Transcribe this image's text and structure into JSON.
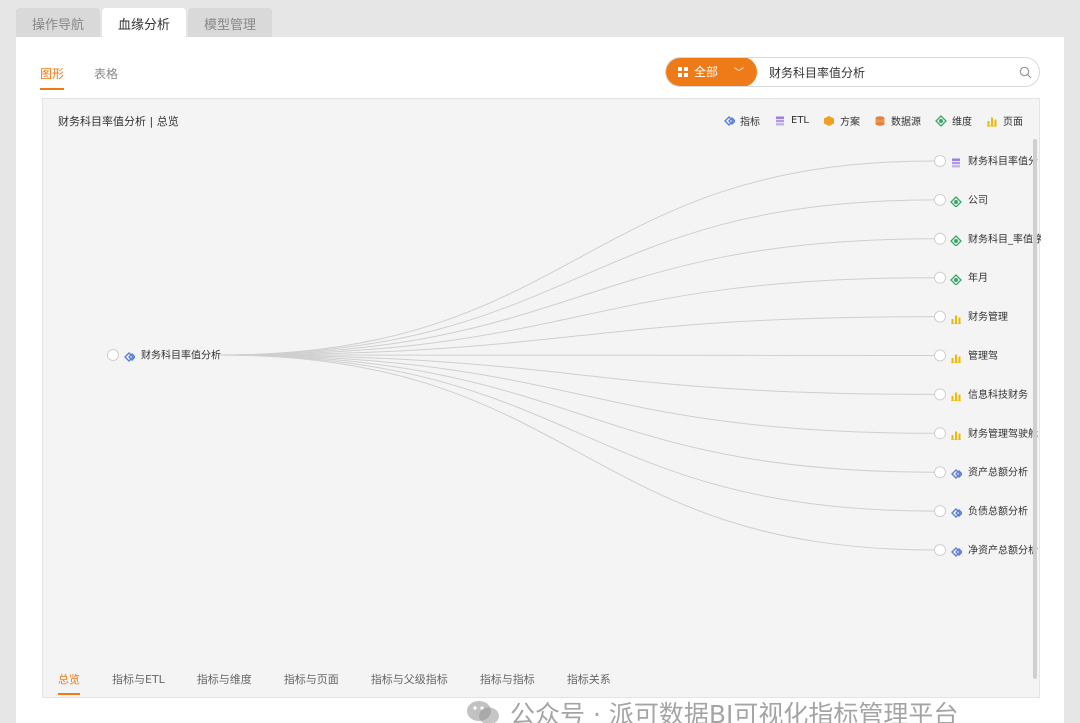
{
  "top_tabs": [
    "操作导航",
    "血缘分析",
    "模型管理"
  ],
  "view_tabs": [
    "图形",
    "表格"
  ],
  "search": {
    "filter_label": "全部",
    "value": "财务科目率值分析"
  },
  "canvas": {
    "title": "财务科目率值分析 | 总览"
  },
  "legend": [
    {
      "label": "指标",
      "icon": "indicator-icon"
    },
    {
      "label": "ETL",
      "icon": "etl-icon"
    },
    {
      "label": "方案",
      "icon": "plan-icon"
    },
    {
      "label": "数据源",
      "icon": "datasource-icon"
    },
    {
      "label": "维度",
      "icon": "dimension-icon"
    },
    {
      "label": "页面",
      "icon": "page-icon"
    }
  ],
  "graph": {
    "root": {
      "label": "财务科目率值分析",
      "type": "indicator"
    },
    "nodes": [
      {
        "label": "财务科目率值分",
        "type": "etl"
      },
      {
        "label": "公司",
        "type": "dimension"
      },
      {
        "label": "财务科目_率值序",
        "type": "dimension"
      },
      {
        "label": "年月",
        "type": "dimension"
      },
      {
        "label": "财务管理",
        "type": "page"
      },
      {
        "label": "管理驾",
        "type": "page"
      },
      {
        "label": "信息科技财务",
        "type": "page"
      },
      {
        "label": "财务管理驾驶舱",
        "type": "page"
      },
      {
        "label": "资产总额分析",
        "type": "indicator"
      },
      {
        "label": "负债总额分析",
        "type": "indicator"
      },
      {
        "label": "净资产总额分析",
        "type": "indicator"
      }
    ]
  },
  "bottom_tabs": [
    "总览",
    "指标与ETL",
    "指标与维度",
    "指标与页面",
    "指标与父级指标",
    "指标与指标",
    "指标关系"
  ],
  "watermark": "公众号 · 派可数据BI可视化指标管理平台",
  "colors": {
    "accent": "#ee7a18",
    "indicator": "#5a7fd6",
    "etl": "#9b7be0",
    "plan": "#f0a020",
    "datasource": "#e8823a",
    "dimension": "#39a864",
    "page": "#f0b800"
  }
}
